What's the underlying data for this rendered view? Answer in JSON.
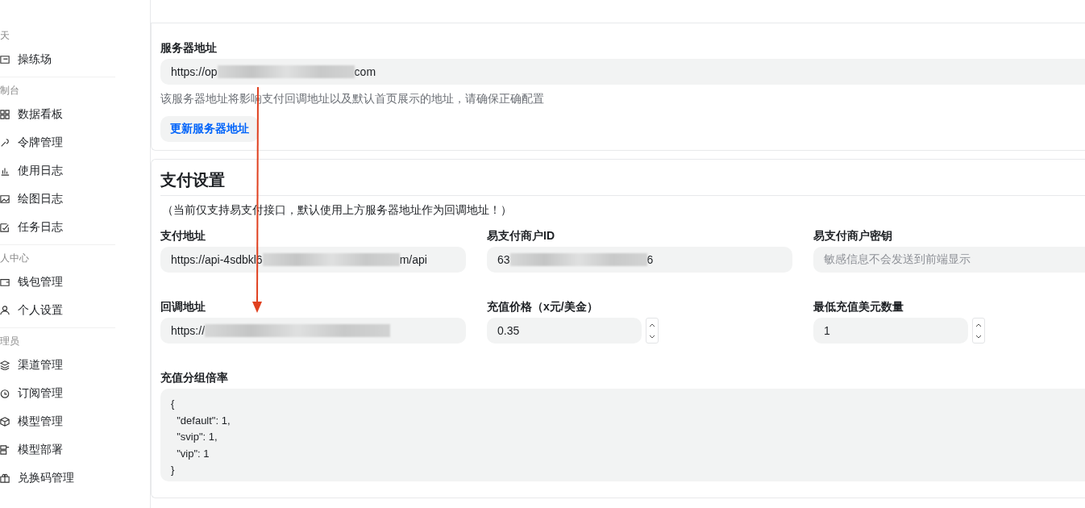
{
  "sidebar": {
    "sections": [
      {
        "title": "天",
        "items": [
          {
            "label": "操练场"
          }
        ]
      },
      {
        "title": "制台",
        "items": [
          {
            "label": "数据看板"
          },
          {
            "label": "令牌管理"
          },
          {
            "label": "使用日志"
          },
          {
            "label": "绘图日志"
          },
          {
            "label": "任务日志"
          }
        ]
      },
      {
        "title": "人中心",
        "items": [
          {
            "label": "钱包管理"
          },
          {
            "label": "个人设置"
          }
        ]
      },
      {
        "title": "理员",
        "items": [
          {
            "label": "渠道管理"
          },
          {
            "label": "订阅管理"
          },
          {
            "label": "模型管理"
          },
          {
            "label": "模型部署"
          },
          {
            "label": "兑换码管理"
          }
        ]
      }
    ]
  },
  "server": {
    "label": "服务器地址",
    "field": {
      "prefix": "https://op",
      "suffix": "com",
      "redacted": true
    },
    "help": "该服务器地址将影响支付回调地址以及默认首页展示的地址，请确保正确配置",
    "button": "更新服务器地址"
  },
  "payment": {
    "title": "支付设置",
    "note": "（当前仅支持易支付接口，默认使用上方服务器地址作为回调地址！）",
    "fields": [
      {
        "kind": "text",
        "label": "支付地址",
        "prefix": "https://api-4sdbkl6",
        "suffix": "m/api",
        "redacted": true
      },
      {
        "kind": "text",
        "label": "易支付商户ID",
        "prefix": "63",
        "suffix": "6",
        "redacted": true
      },
      {
        "kind": "text",
        "label": "易支付商户密钥",
        "placeholder": "敏感信息不会发送到前端显示"
      },
      {
        "kind": "text",
        "label": "回调地址",
        "prefix": "https://",
        "redacted": true
      },
      {
        "kind": "number",
        "label": "充值价格（x元/美金）",
        "value": "0.35"
      },
      {
        "kind": "number",
        "label": "最低充值美元数量",
        "value": "1"
      },
      {
        "kind": "textarea",
        "label": "充值分组倍率",
        "value": "{\n  \"default\": 1,\n  \"svip\": 1,\n  \"vip\": 1\n}"
      }
    ]
  }
}
